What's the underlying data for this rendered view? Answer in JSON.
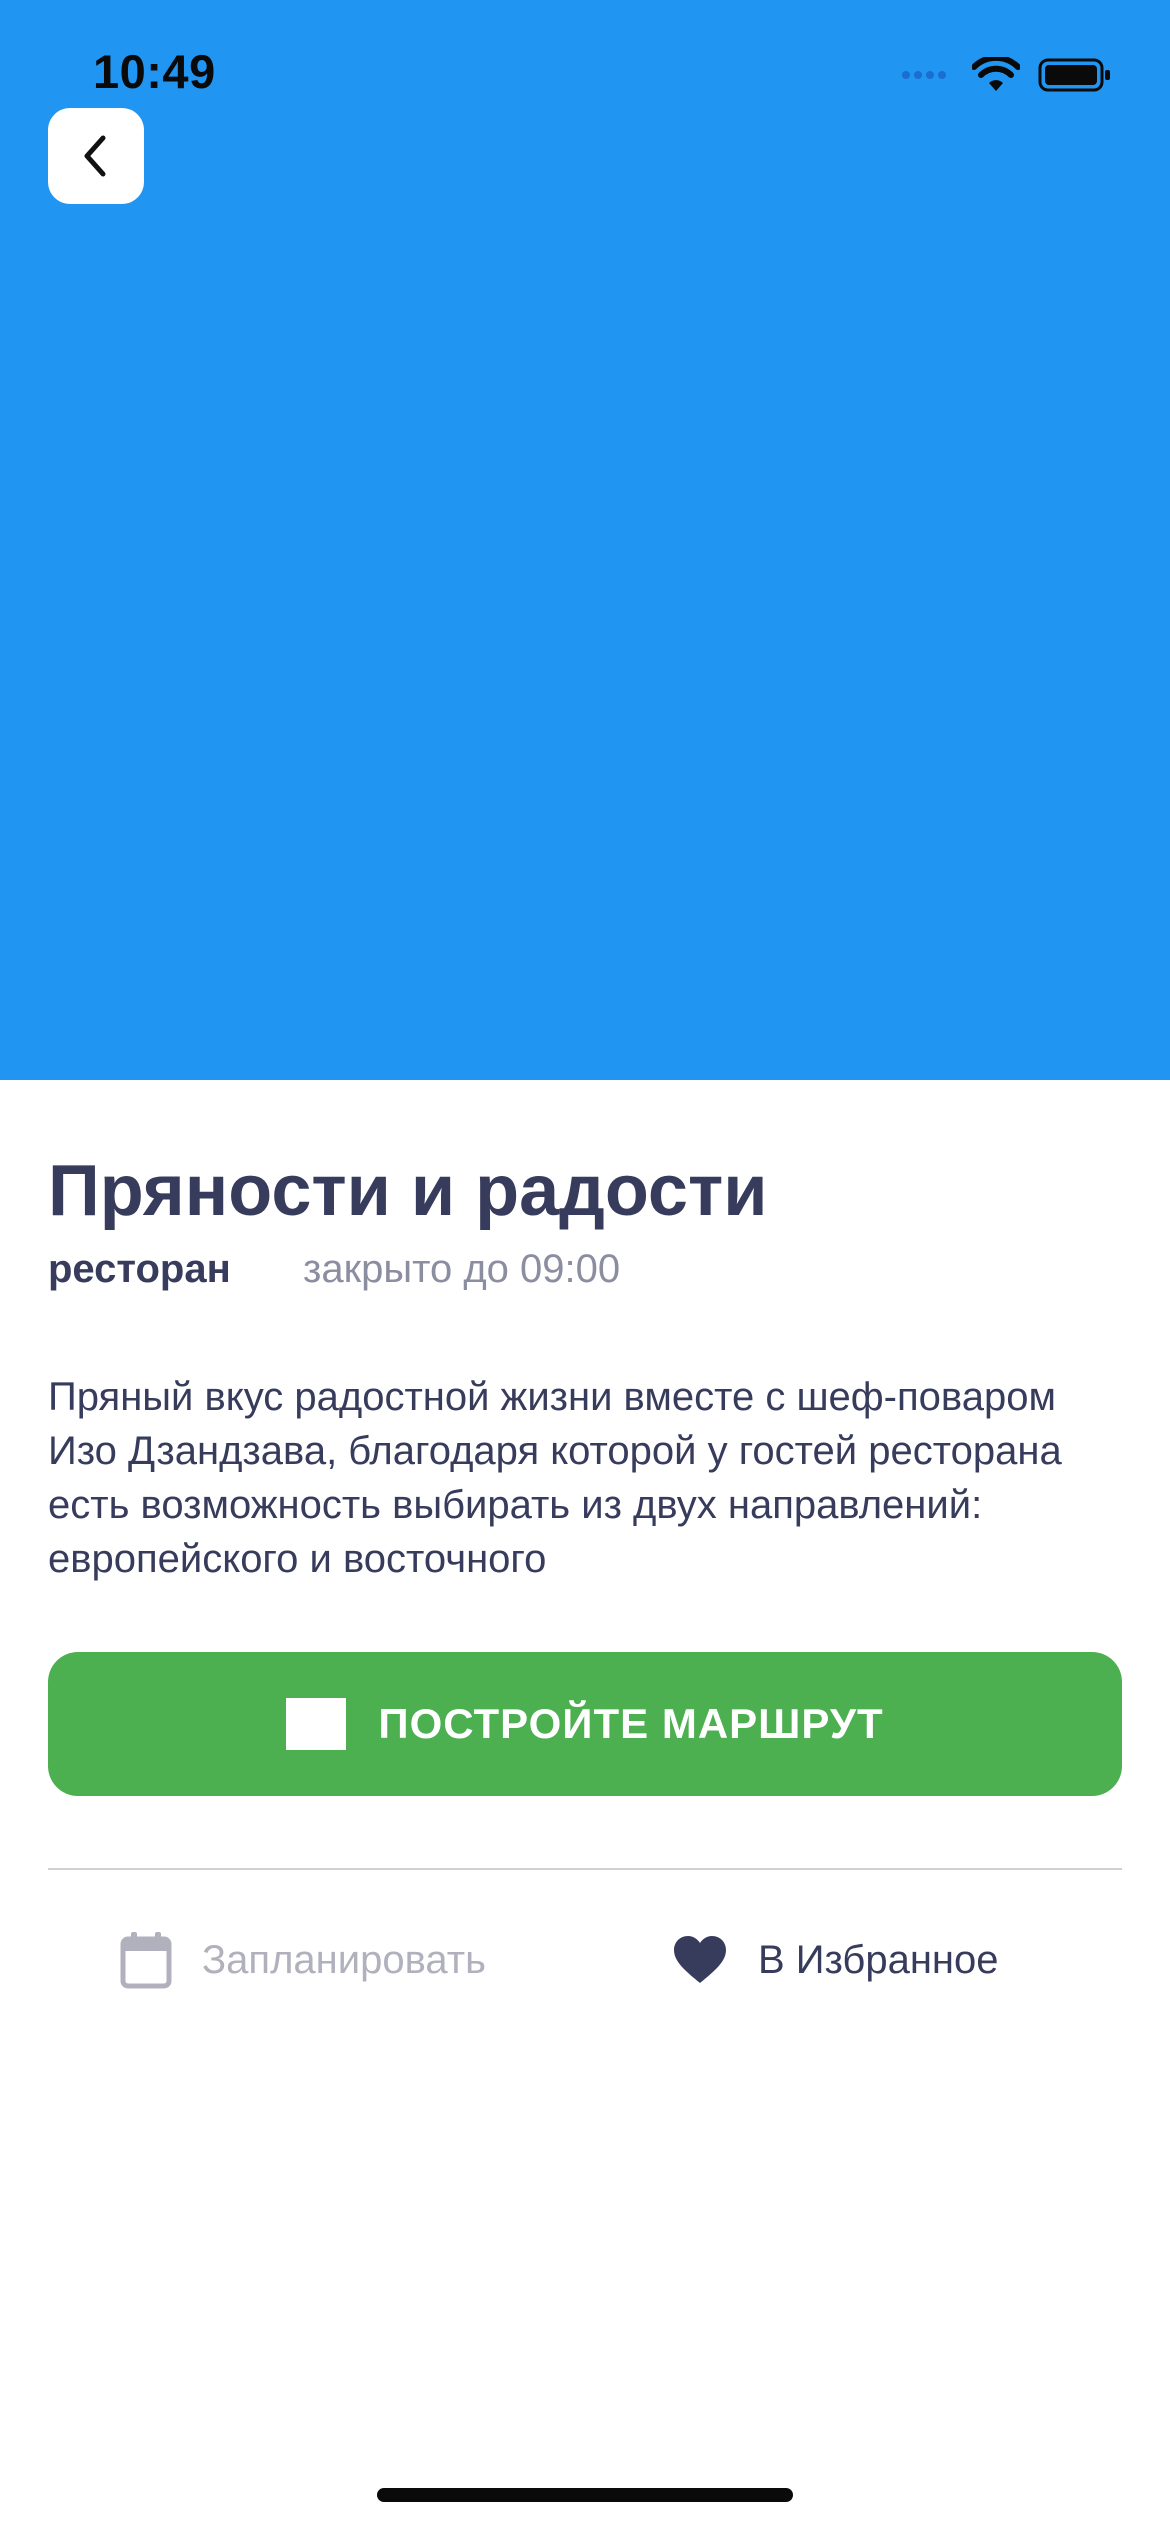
{
  "status_bar": {
    "time": "10:49",
    "icons": [
      "signal-icon",
      "wifi-icon",
      "battery-icon"
    ]
  },
  "hero": {
    "color": "#2195F2"
  },
  "place": {
    "title": "Пряности и радости",
    "category": "ресторан",
    "hours": "закрыто до 09:00",
    "description": "Пряный вкус радостной жизни вместе с шеф-поваром Изо Дзандзава, благодаря которой у гостей ресторана есть возможность выбирать из двух направлений: европейского и восточного"
  },
  "actions": {
    "route_label": "ПОСТРОЙТЕ МАРШРУТ",
    "route_color": "#4CAF50",
    "plan_label": "Запланировать",
    "favorite_label": "В Избранное"
  },
  "icons": {
    "back": "chevron-left-icon",
    "route": "route-icon",
    "plan": "calendar-icon",
    "favorite": "heart-icon"
  }
}
